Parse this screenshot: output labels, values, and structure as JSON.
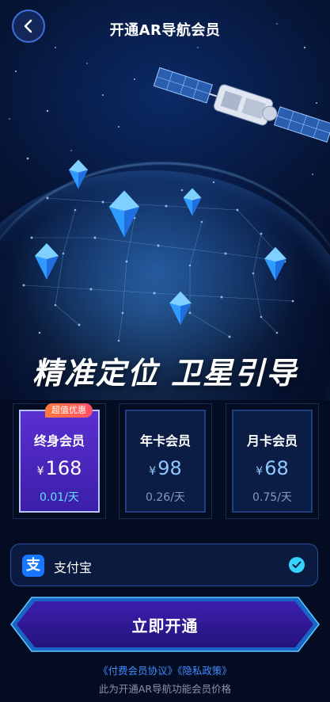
{
  "header": {
    "title": "开通AR导航会员"
  },
  "hero": {
    "slogan": "精准定位 卫星引导"
  },
  "plans": [
    {
      "name": "终身会员",
      "currency": "¥",
      "price": "168",
      "per_day": "0.01/天",
      "badge": "超值优惠",
      "selected": true
    },
    {
      "name": "年卡会员",
      "currency": "¥",
      "price": "98",
      "per_day": "0.26/天",
      "selected": false
    },
    {
      "name": "月卡会员",
      "currency": "¥",
      "price": "68",
      "per_day": "0.75/天",
      "selected": false
    }
  ],
  "payment": {
    "method_label": "支付宝",
    "icon_glyph": "支",
    "selected": true
  },
  "cta": {
    "label": "立即开通"
  },
  "footer": {
    "links": "《付费会员协议》《隐私政策》",
    "note": "此为开通AR导航功能会员价格"
  },
  "colors": {
    "background": "#040c22",
    "accent": "#35d4ff",
    "selected_plan": "#4a27c0",
    "badge": "#ff5e4e",
    "link": "#3f8cff"
  }
}
